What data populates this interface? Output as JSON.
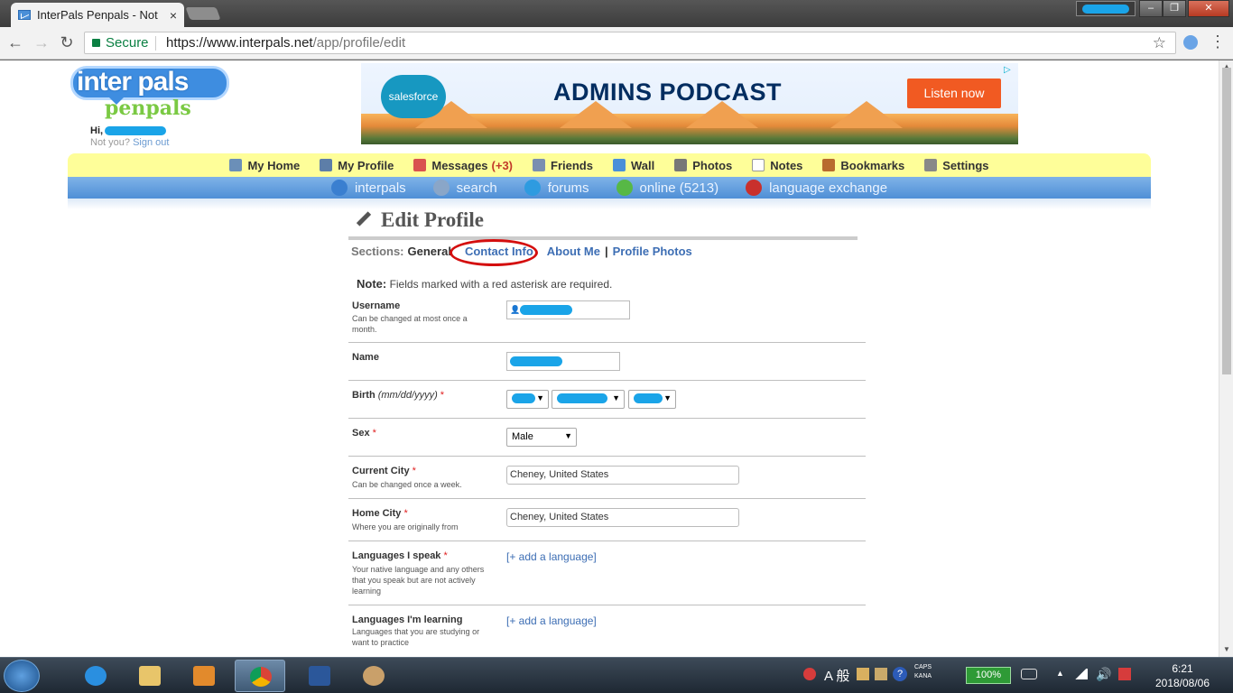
{
  "browser": {
    "tab_title": "InterPals Penpals - Not",
    "tab_close": "×",
    "secure_label": "Secure",
    "url_scheme_host": "https://www.interpals.net",
    "url_path": "/app/profile/edit",
    "back_icon": "←",
    "forward_icon": "→",
    "reload_icon": "↻",
    "star_icon": "☆",
    "menu_icon": "⋮",
    "win_min": "–",
    "win_max": "❐",
    "win_close": "✕"
  },
  "header": {
    "logo_word1": "inter pals",
    "logo_word2": "penpals",
    "greeting": "Hi,",
    "not_you": "Not you?",
    "sign_out": "Sign out"
  },
  "ad": {
    "brand": "salesforce",
    "headline": "ADMINS PODCAST",
    "cta": "Listen now",
    "adchoice": "▷"
  },
  "nav_primary": [
    {
      "label": "My Home",
      "icon": "home-icon",
      "color": "#6b8fb8"
    },
    {
      "label": "My Profile",
      "icon": "profile-icon",
      "color": "#5d7ea8"
    },
    {
      "label": "Messages",
      "count": "(+3)",
      "icon": "envelope-icon",
      "color": "#d9534f"
    },
    {
      "label": "Friends",
      "icon": "friends-icon",
      "color": "#7a8fb0"
    },
    {
      "label": "Wall",
      "icon": "wall-icon",
      "color": "#4a90d9"
    },
    {
      "label": "Photos",
      "icon": "photos-icon",
      "color": "#777"
    },
    {
      "label": "Notes",
      "icon": "notes-icon",
      "color": "#999"
    },
    {
      "label": "Bookmarks",
      "icon": "bookmark-icon",
      "color": "#b86b2e"
    },
    {
      "label": "Settings",
      "icon": "settings-icon",
      "color": "#888"
    }
  ],
  "nav_secondary": [
    {
      "label": "interpals",
      "icon": "globe-icon",
      "color": "#3a7fd0"
    },
    {
      "label": "search",
      "icon": "magnifier-icon",
      "color": "#8aa6c8"
    },
    {
      "label": "forums",
      "icon": "forum-bubble-icon",
      "color": "#2e9be0"
    },
    {
      "label": "online (5213)",
      "icon": "online-users-icon",
      "color": "#57b846"
    },
    {
      "label": "language exchange",
      "icon": "flag-icon",
      "color": "#c9302c"
    }
  ],
  "page": {
    "title": "Edit Profile",
    "sections_label": "Sections:",
    "section_current": "General",
    "section_links": [
      "Contact Info",
      "About Me",
      "Profile Photos"
    ],
    "separator": "|",
    "note_label": "Note:",
    "note_text": "Fields marked with a red asterisk are required."
  },
  "form": {
    "username_label": "Username",
    "username_help": "Can be changed at most once a month.",
    "name_label": "Name",
    "birth_label": "Birth",
    "birth_format": "(mm/dd/yyyy)",
    "sex_label": "Sex",
    "sex_value": "Male",
    "current_city_label": "Current City",
    "current_city_help": "Can be changed once a week.",
    "current_city_value": "Cheney, United States",
    "home_city_label": "Home City",
    "home_city_help": "Where you are originally from",
    "home_city_value": "Cheney, United States",
    "languages_speak_label": "Languages I speak",
    "languages_speak_help": "Your native language and any others that you speak but are not actively learning",
    "languages_learning_label": "Languages I'm learning",
    "languages_learning_help": "Languages that you are studying or want to practice",
    "add_language": "[+ add a language]",
    "required_mark": "*",
    "dropdown_arrow": "▼"
  },
  "taskbar": {
    "ime_text": "A 般",
    "caps_text": "CAPS",
    "kana_text": "KANA",
    "battery": "100%",
    "time": "6:21",
    "date": "2018/08/06"
  }
}
